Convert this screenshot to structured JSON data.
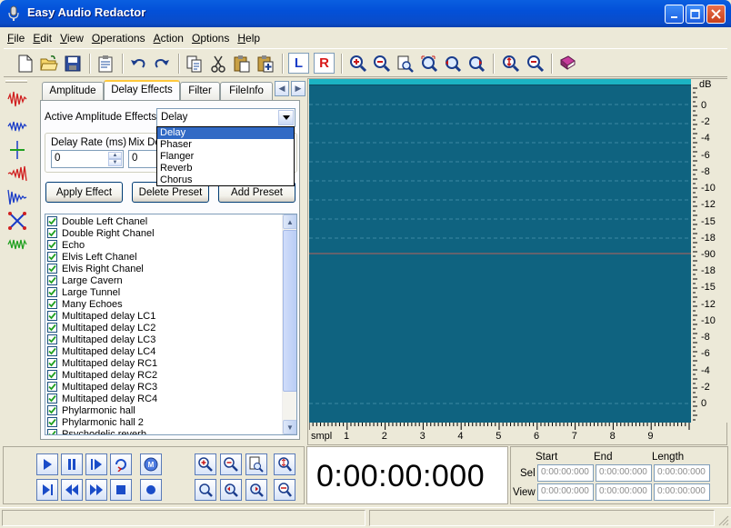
{
  "window": {
    "title": "Easy Audio Redactor",
    "controls": [
      "minimize",
      "maximize",
      "close"
    ]
  },
  "menu": [
    {
      "label": "File",
      "hotkey": "F",
      "rest": "ile"
    },
    {
      "label": "Edit",
      "hotkey": "E",
      "rest": "dit"
    },
    {
      "label": "View",
      "hotkey": "V",
      "rest": "iew"
    },
    {
      "label": "Operations",
      "hotkey": "O",
      "rest": "perations"
    },
    {
      "label": "Action",
      "hotkey": "A",
      "rest": "ction"
    },
    {
      "label": "Options",
      "hotkey": "O",
      "rest": "ptions"
    },
    {
      "label": "Help",
      "hotkey": "H",
      "rest": "elp"
    }
  ],
  "toolbar": {
    "icons": [
      "new-file-icon",
      "open-folder-icon",
      "save-icon",
      "properties-icon",
      "undo-icon",
      "redo-icon",
      "copy-icon",
      "cut-icon",
      "paste-icon",
      "paste-mix-icon",
      "zoom-in-icon",
      "zoom-out-icon",
      "zoom-selection-icon",
      "zoom-fit-icon",
      "zoom-left-icon",
      "zoom-right-icon",
      "zoom-in-vertical-icon",
      "zoom-out-vertical-icon",
      "help-book-icon"
    ],
    "left_channel": "L",
    "right_channel": "R"
  },
  "effect_panel": {
    "tabs": [
      "Amplitude",
      "Delay Effects",
      "Filter",
      "FileInfo"
    ],
    "active_tab": "Delay Effects",
    "active_effects_label": "Active Amplitude Effects",
    "active_effect_value": "Delay",
    "dropdown_options": [
      "Delay",
      "Phaser",
      "Flanger",
      "Reverb",
      "Chorus"
    ],
    "delay_rate_label": "Delay Rate (ms)",
    "delay_rate_value": "0",
    "mix_label": "Mix De",
    "mix_value": "0",
    "apply_button": "Apply Effect",
    "delete_button": "Delete Preset",
    "add_button": "Add Preset",
    "presets": [
      "Double Left Chanel",
      "Double Right Chanel",
      "Echo",
      "Elvis Left Chanel",
      "Elvis Right Chanel",
      "Large Cavern",
      "Large Tunnel",
      "Many Echoes",
      "Multitaped delay LC1",
      "Multitaped delay LC2",
      "Multitaped delay LC3",
      "Multitaped delay LC4",
      "Multitaped delay RC1",
      "Multitaped delay RC2",
      "Multitaped delay RC3",
      "Multitaped delay RC4",
      "Phylarmonic hall",
      "Phylarmonic hall 2",
      "Psychodelic reverb"
    ]
  },
  "waveform": {
    "db_unit": "dB",
    "db_labels": [
      "0",
      "-2",
      "-4",
      "-6",
      "-8",
      "-10",
      "-12",
      "-15",
      "-18",
      "-90",
      "-18",
      "-15",
      "-12",
      "-10",
      "-8",
      "-6",
      "-4",
      "-2",
      "0"
    ],
    "x_unit": "smpl",
    "x_ticks": [
      "1",
      "2",
      "3",
      "4",
      "5",
      "6",
      "7",
      "8",
      "9"
    ],
    "background_color": "#0F6380",
    "top_bar_color": "#1BB3C3"
  },
  "transport": {
    "time_display": "0:00:00:000",
    "columns": [
      "Start",
      "End",
      "Length"
    ],
    "rows": [
      "Sel",
      "View"
    ],
    "fields": {
      "sel": [
        "0:00:00:000",
        "0:00:00:000",
        "0:00:00:000"
      ],
      "view": [
        "0:00:00:000",
        "0:00:00:000",
        "0:00:00:000"
      ]
    }
  }
}
